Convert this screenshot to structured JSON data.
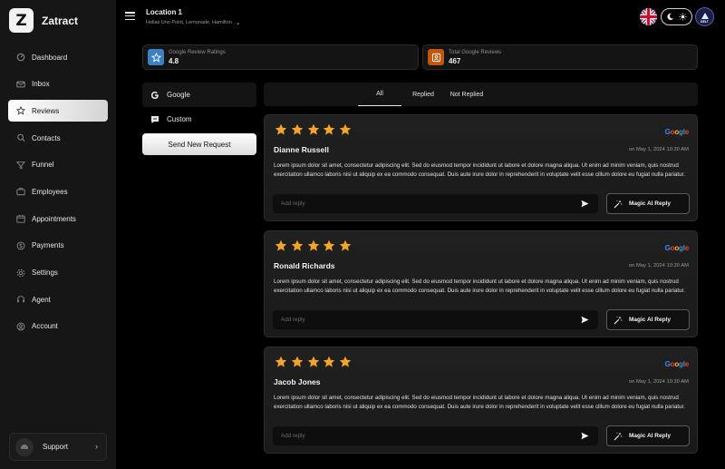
{
  "app": {
    "name": "Zatract",
    "logo_glyph": "Z"
  },
  "sidebar": {
    "items": [
      {
        "label": "Dashboard",
        "icon": "dashboard-icon",
        "active": false
      },
      {
        "label": "Inbox",
        "icon": "inbox-icon",
        "active": false
      },
      {
        "label": "Reviews",
        "icon": "star-icon",
        "active": true
      },
      {
        "label": "Contacts",
        "icon": "contacts-icon",
        "active": false
      },
      {
        "label": "Funnel",
        "icon": "funnel-icon",
        "active": false
      },
      {
        "label": "Employees",
        "icon": "employees-icon",
        "active": false
      },
      {
        "label": "Appointments",
        "icon": "calendar-icon",
        "active": false
      },
      {
        "label": "Payments",
        "icon": "payments-icon",
        "active": false
      },
      {
        "label": "Settings",
        "icon": "gear-icon",
        "active": false
      },
      {
        "label": "Agent",
        "icon": "headset-icon",
        "active": false
      },
      {
        "label": "Account",
        "icon": "account-icon",
        "active": false
      }
    ],
    "support_label": "Support"
  },
  "header": {
    "location_title": "Location 1",
    "location_address": "Hollas Uno Point, Lemonade, Hamilton"
  },
  "stats": [
    {
      "label": "Google Review Ratings",
      "value": "4.8",
      "icon": "star-icon",
      "color": "#3b82c4"
    },
    {
      "label": "Total Google Reviews",
      "value": "467",
      "icon": "user-icon",
      "color": "#c2570c"
    }
  ],
  "sources": [
    {
      "label": "Google",
      "icon": "google-icon",
      "active": true
    },
    {
      "label": "Custom",
      "icon": "chat-icon",
      "active": false
    }
  ],
  "send_request_label": "Send New Request",
  "tabs": [
    {
      "label": "All",
      "active": true
    },
    {
      "label": "Replied",
      "active": false
    },
    {
      "label": "Not Replied",
      "active": false
    }
  ],
  "reviews": [
    {
      "name": "Dianne Russell",
      "rating": 5,
      "source": "Google",
      "date": "on May 1, 2024  10:30 AM",
      "body": "Lorem ipsum dolor sit amet, consectetur adipiscing elit. Sed do eiusmod tempor incididunt ut labore et dolore magna aliqua. Ut enim ad minim veniam, quis nostrud exercitation ullamco laboris nisi ut aliquip ex ea commodo consequat. Duis aute irure dolor in reprehenderit in voluptate velit esse cillum dolore eu fugiat nulla pariatur.",
      "reply_placeholder": "Add reply",
      "magic_label": "Magic AI Reply"
    },
    {
      "name": "Ronald Richards",
      "rating": 5,
      "source": "Google",
      "date": "on May 1, 2024  10:30 AM",
      "body": "Lorem ipsum dolor sit amet, consectetur adipiscing elit. Sed do eiusmod tempor incididunt ut labore et dolore magna aliqua. Ut enim ad minim veniam, quis nostrud exercitation ullamco laboris nisi ut aliquip ex ea commodo consequat. Duis aute irure dolor in reprehenderit in voluptate velit esse cillum dolore eu fugiat nulla pariatur.",
      "reply_placeholder": "Add reply",
      "magic_label": "Magic AI Reply"
    },
    {
      "name": "Jacob Jones",
      "rating": 5,
      "source": "Google",
      "date": "on May 1, 2024  10:30 AM",
      "body": "Lorem ipsum dolor sit amet, consectetur adipiscing elit. Sed do eiusmod tempor incididunt ut labore et dolore magna aliqua. Ut enim ad minim veniam, quis nostrud exercitation ullamco laboris nisi ut aliquip ex ea commodo consequat. Duis aute irure dolor in reprehenderit in voluptate velit esse cillum dolore eu fugiat nulla pariatur.",
      "reply_placeholder": "Add reply",
      "magic_label": "Magic AI Reply"
    }
  ],
  "colors": {
    "star": "#f5a524",
    "accent_blue": "#3b82c4",
    "accent_orange": "#c2570c"
  }
}
